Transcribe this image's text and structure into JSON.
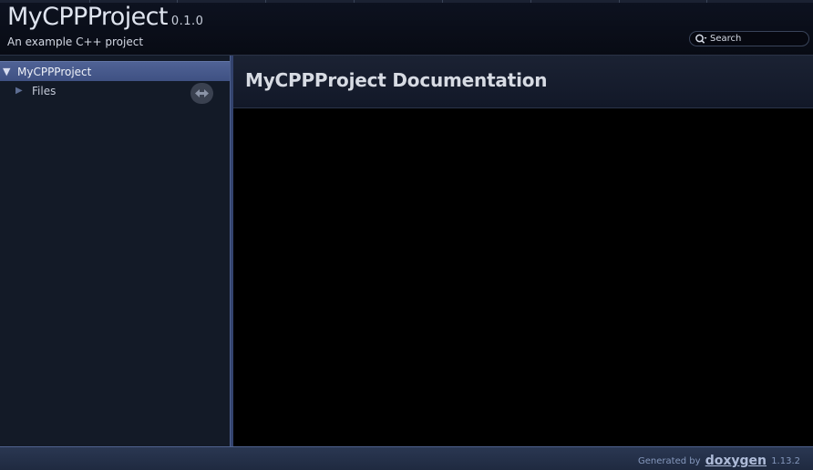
{
  "header": {
    "project_name": "MyCPPProject",
    "project_number": "0.1.0",
    "project_brief": "An example C++ project"
  },
  "search": {
    "placeholder": "Search",
    "icon": "search-icon"
  },
  "nav_tree": {
    "items": [
      {
        "label": "MyCPPProject",
        "expanded": true,
        "selected": true,
        "icon": "caret-down-icon"
      },
      {
        "label": "Files",
        "expanded": false,
        "selected": false,
        "icon": "caret-right-icon"
      }
    ],
    "sync_icon": "sync-arrows-icon"
  },
  "content": {
    "title": "MyCPPProject Documentation"
  },
  "footer": {
    "prefix": "Generated by",
    "brand": "doxygen",
    "version": "1.13.2"
  },
  "colors": {
    "nav_selected": "#4a5c8f",
    "background": "#000000",
    "sidebar": "#131a27",
    "splitter": "#33436e"
  }
}
